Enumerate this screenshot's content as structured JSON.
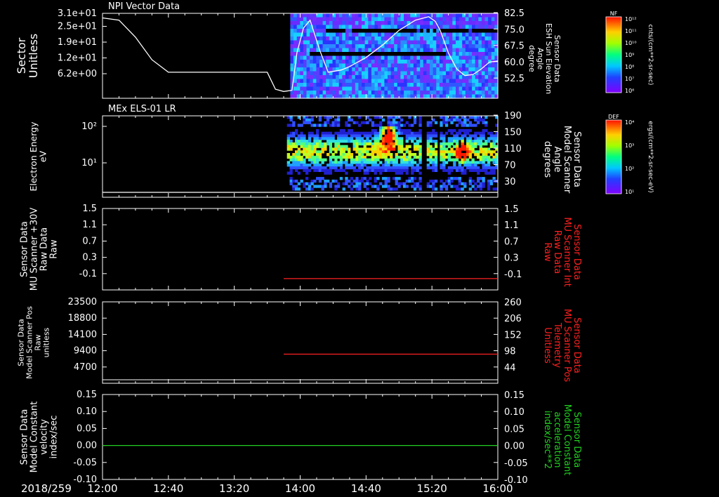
{
  "chart_data": [
    {
      "type": "line",
      "title": "NPI Vector Data",
      "ylabel_left": [
        "Sector",
        "Unitless"
      ],
      "ylabel_right": [
        "Sensor Data",
        "ESH Sun Elevation",
        "Angle",
        "degree"
      ],
      "yticks_left": [
        "3.1e+01",
        "2.5e+01",
        "1.9e+01",
        "1.2e+01",
        "6.2e+00"
      ],
      "yticks_right": [
        "82.5",
        "75.0",
        "67.5",
        "60.0",
        "52.5"
      ],
      "ylim_right": [
        45,
        82.5
      ],
      "spectrogram_start_minute": 114,
      "curve": {
        "x": [
          0,
          10,
          20,
          30,
          40,
          48,
          60,
          80,
          100,
          105,
          110,
          115,
          118,
          122,
          126,
          132,
          137,
          141,
          145,
          150,
          160,
          170,
          180,
          190,
          198,
          202,
          205,
          210,
          215,
          220,
          225,
          230,
          235,
          240
        ],
        "y": [
          80.5,
          79.5,
          72,
          62,
          56.5,
          56.5,
          56.5,
          56.5,
          56.5,
          49,
          48,
          48.5,
          65,
          76,
          79.5,
          66,
          56.5,
          57,
          57.5,
          59,
          63,
          68.5,
          75,
          79.5,
          81,
          79,
          75,
          65,
          58,
          55,
          55.5,
          58,
          61,
          61.5
        ]
      },
      "colorbar": {
        "label": "NF",
        "units": "cnts/(cm**2-sr-sec)",
        "ticks": [
          "10¹²",
          "10¹¹",
          "10¹⁰",
          "10⁹",
          "10⁸",
          "10⁷",
          "10⁶"
        ]
      }
    },
    {
      "type": "heatmap",
      "title": "MEx ELS-01 LR",
      "ylabel_left": [
        "Electron Energy",
        "eV"
      ],
      "ylabel_right": [
        "Sensor Data",
        "Model Scanner",
        "Angle",
        "degrees"
      ],
      "yticks_left": [
        "10²",
        "10¹"
      ],
      "yticks_right": [
        "190",
        "150",
        "110",
        "70",
        "30"
      ],
      "ylim_right": [
        0,
        190
      ],
      "line_value": 0,
      "spectrogram_start_minute": 112,
      "colorbar": {
        "label": "DEF",
        "units": "ergs/(cm**2-sr-sec-eV)",
        "ticks": [
          "10⁴",
          "10³",
          "10²",
          "10¹"
        ]
      }
    },
    {
      "type": "line",
      "ylabel_left": [
        "Sensor Data",
        "MU Scanner +30V",
        "Raw Data",
        "Raw"
      ],
      "ylabel_right": [
        "Sensor Data",
        "MU Scanner Int",
        "Raw Data",
        "Raw"
      ],
      "yticks_left": [
        "1.5",
        "1.1",
        "0.7",
        "0.3",
        "-0.1"
      ],
      "yticks_right": [
        "1.5",
        "1.1",
        "0.7",
        "0.3",
        "-0.1"
      ],
      "ylim": [
        -0.3,
        1.5
      ],
      "series": [
        {
          "x": [
            110,
            240
          ],
          "y": [
            -0.05,
            -0.05
          ],
          "color": "#ff2020"
        }
      ]
    },
    {
      "type": "line",
      "ylabel_left": [
        "Sensor Data",
        "Model Scanner Pos",
        "Raw",
        "unitless"
      ],
      "ylabel_right": [
        "Sensor Data",
        "MU Scanner Pos",
        "Telemetry",
        "Unitless"
      ],
      "yticks_left": [
        "23500",
        "18800",
        "14100",
        "9400",
        "4700"
      ],
      "yticks_right": [
        "260",
        "206",
        "152",
        "98",
        "44"
      ],
      "ylim": [
        0,
        23500
      ],
      "series": [
        {
          "x": [
            110,
            240
          ],
          "y": [
            8400,
            8400
          ],
          "color": "#ff2020"
        }
      ]
    },
    {
      "type": "line",
      "ylabel_left": [
        "Sensor Data",
        "Model Constant",
        "velocity",
        "index/sec"
      ],
      "ylabel_right": [
        "Sensor Data",
        "Model Constant",
        "acceleration",
        "index/sec**2"
      ],
      "yticks_left": [
        "0.15",
        "0.10",
        "0.05",
        "0.00",
        "-0.05",
        "-0.10"
      ],
      "yticks_right": [
        "0.15",
        "0.10",
        "0.05",
        "0.00",
        "-0.05",
        "-0.10"
      ],
      "ylim": [
        -0.1,
        0.15
      ],
      "series": [
        {
          "x": [
            0,
            240
          ],
          "y": [
            0,
            0
          ],
          "color": "#20d020"
        }
      ]
    }
  ],
  "x_axis": {
    "date": "2018/259",
    "ticks": [
      "12:00",
      "12:40",
      "13:20",
      "14:00",
      "14:40",
      "15:20",
      "16:00"
    ]
  },
  "colors": {
    "red_label": "#ff2020",
    "green_label": "#20d020"
  }
}
